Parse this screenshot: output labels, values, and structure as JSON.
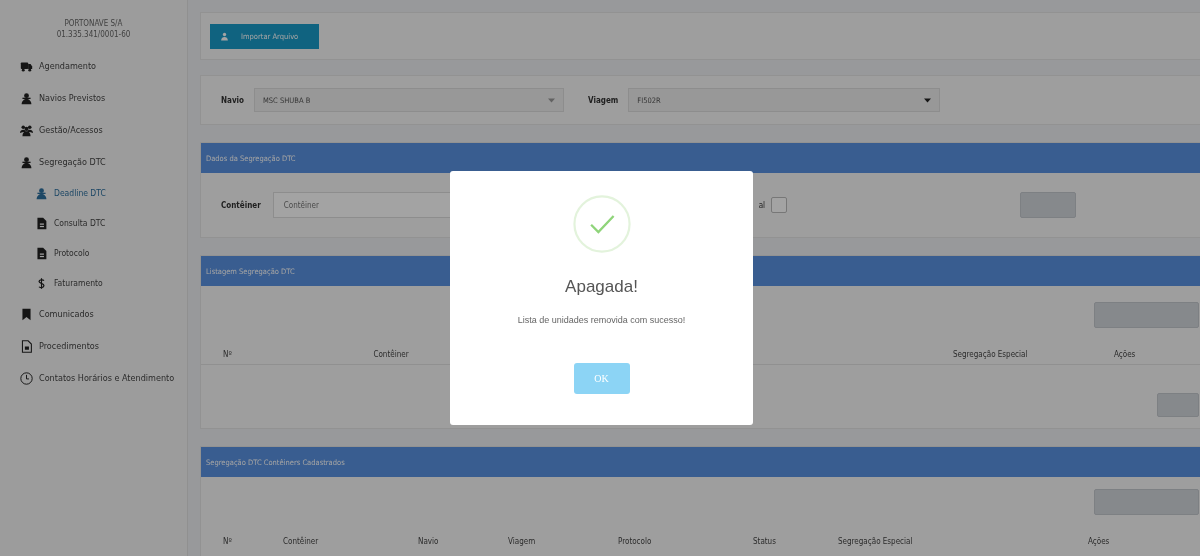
{
  "sidebar": {
    "company": [
      "PORTONAVE S/A",
      "01.335.341/0001-60"
    ],
    "items": [
      {
        "label": "Agendamento",
        "kind": "truck",
        "selected": false
      },
      {
        "label": "Navios Previstos",
        "kind": "person",
        "selected": false
      },
      {
        "label": "Gestão/Acessos",
        "kind": "users",
        "selected": false
      },
      {
        "label": "Segregação DTC",
        "kind": "person",
        "selected": false,
        "children": [
          {
            "label": "Deadline DTC",
            "kind": "person",
            "selected": true
          },
          {
            "label": "Consulta DTC",
            "kind": "file",
            "selected": false
          },
          {
            "label": "Protocolo",
            "kind": "file",
            "selected": false
          },
          {
            "label": "Faturamento",
            "kind": "dollar",
            "selected": false
          }
        ]
      },
      {
        "label": "Comunicados",
        "kind": "bookmark",
        "selected": false
      },
      {
        "label": "Procedimentos",
        "kind": "doc",
        "selected": false
      },
      {
        "label": "Contatos Horários e Atendimento",
        "kind": "clock",
        "selected": false
      }
    ]
  },
  "import_button": "Importar Arquivo",
  "filters": {
    "navio_label": "Navio",
    "navio_value": "MSC SHUBA B",
    "viagem_label": "Viagem",
    "viagem_value": "FI502R"
  },
  "dados_panel": {
    "title": "Dados da Segregação DTC",
    "container_label": "Contêiner",
    "container_placeholder": "Contêiner",
    "checkbox_label": "al",
    "checked": false
  },
  "listagem_panel": {
    "title": "Listagem Segregação DTC",
    "columns": [
      "Nº",
      "Contêiner",
      "Segregação Especial",
      "Ações"
    ]
  },
  "cadastrados_panel": {
    "title": "Segregação DTC Contêiners Cadastrados",
    "columns": [
      "Nº",
      "Contêiner",
      "Navio",
      "Viagem",
      "Protocolo",
      "Status",
      "Segregação Especial",
      "Ações"
    ]
  },
  "dialog": {
    "title": "Apagada!",
    "message": "Lista de unidades removida com sucesso!",
    "button": "OK"
  }
}
